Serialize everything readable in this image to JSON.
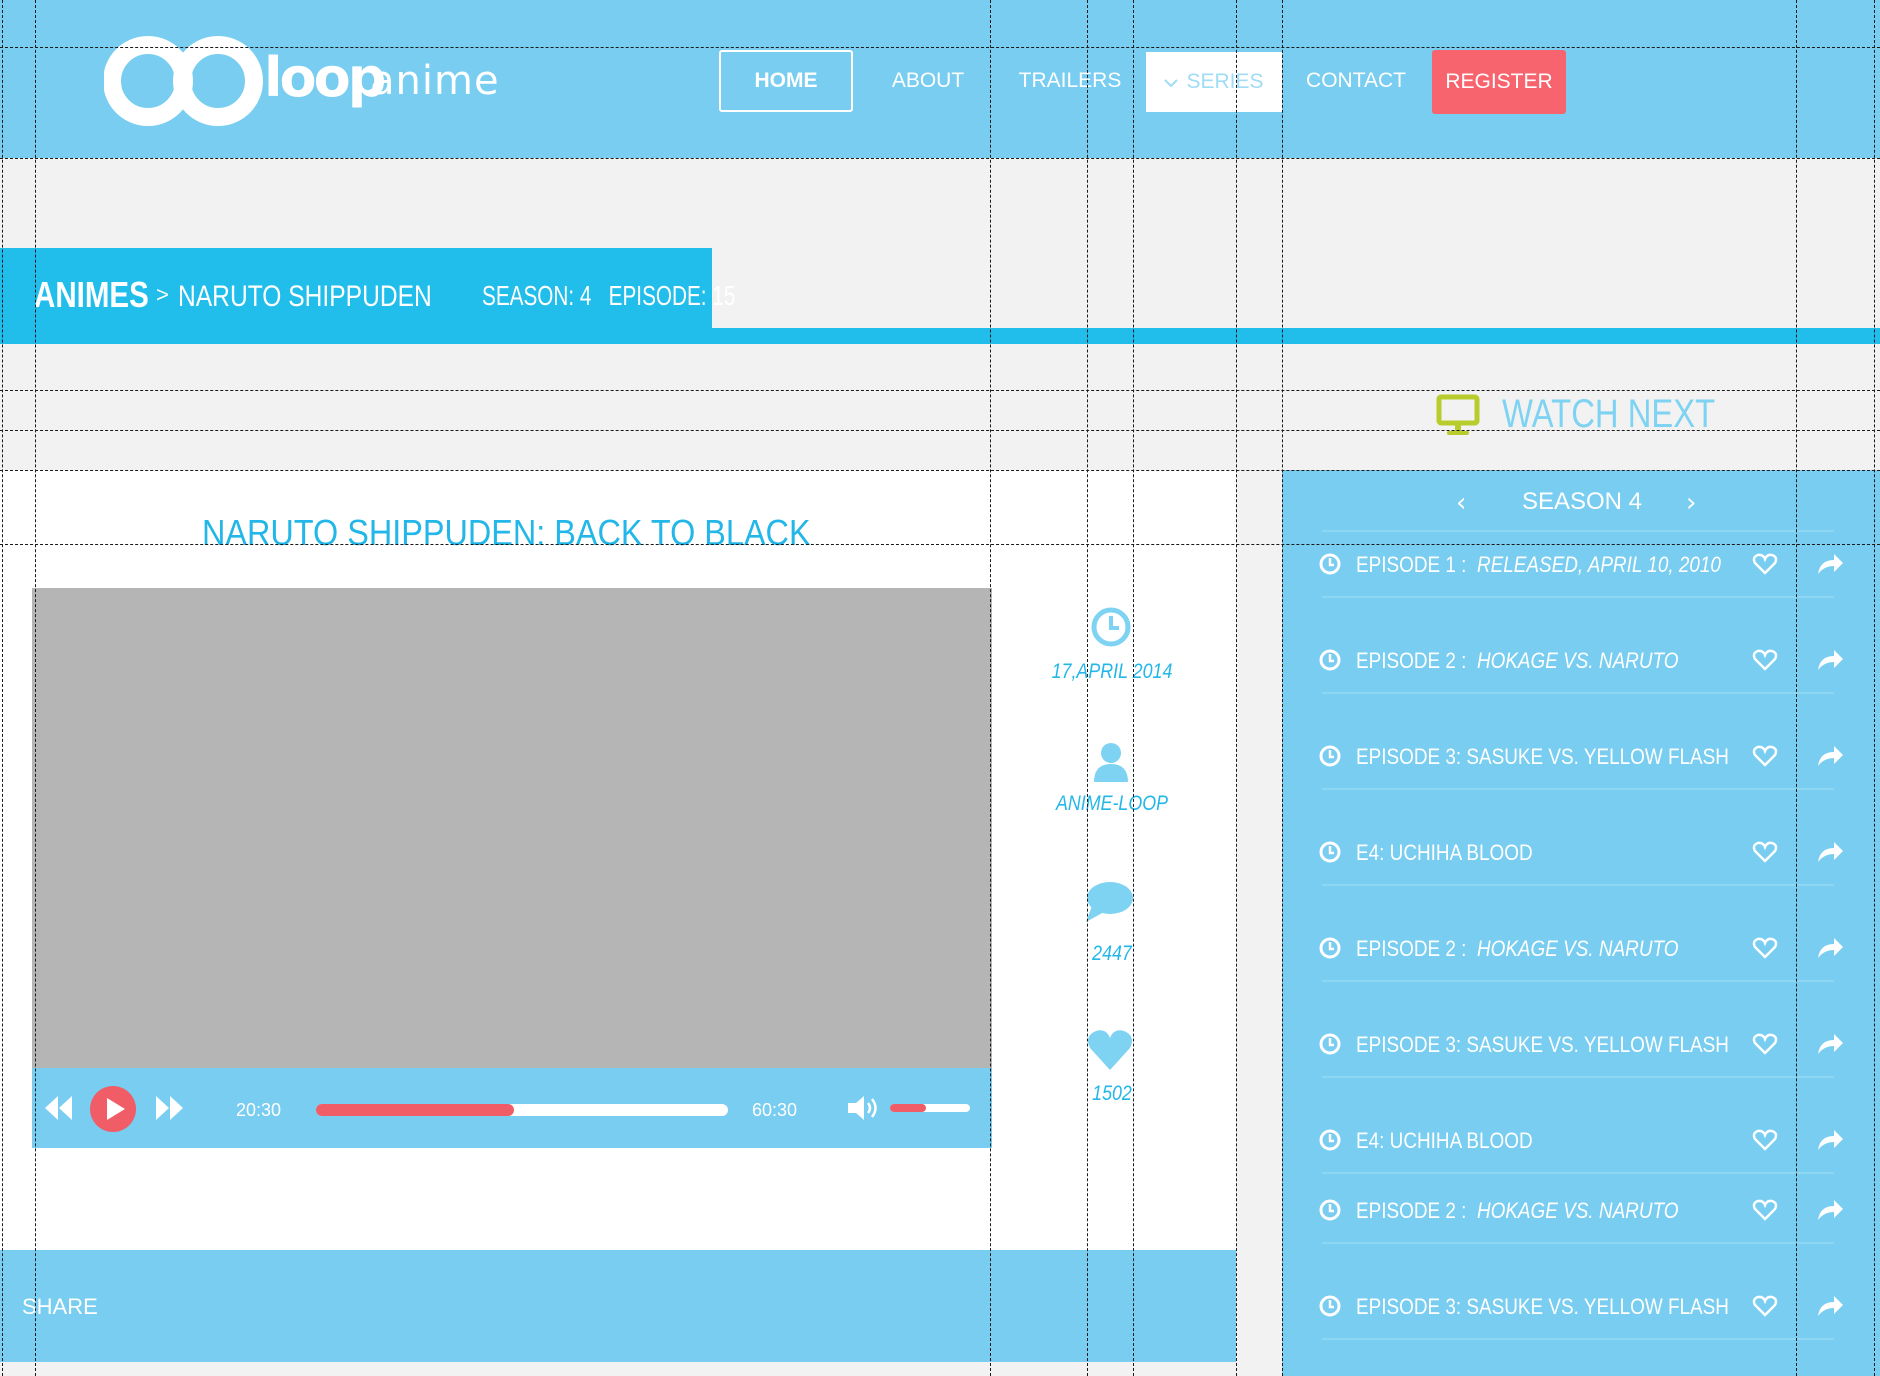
{
  "brand": {
    "name_bold": "loop",
    "name_light": "anime"
  },
  "nav": {
    "home": "HOME",
    "about": "ABOUT",
    "trailers": "TRAILERS",
    "series": "SERIES",
    "contact": "CONTACT",
    "register": "REGISTER"
  },
  "breadcrumb": {
    "root": "ANIMES",
    "separator": ">",
    "show": "NARUTO SHIPPUDEN",
    "episode_info": "SEASON: 4   EPISODE: 15"
  },
  "watch_next": {
    "title": "WATCH NEXT"
  },
  "video": {
    "title": "NARUTO SHIPPUDEN: BACK TO BLACK",
    "current_time": "20:30",
    "total_time": "60:30",
    "progress": 0.48,
    "volume": 0.45
  },
  "meta": {
    "date": "17,APRIL 2014",
    "author": "ANIME-LOOP",
    "comments": "2447",
    "likes": "1502"
  },
  "share": {
    "label": "SHARE"
  },
  "sidebar": {
    "season_label": "SEASON 4",
    "prev": "‹",
    "next": "›",
    "episodes": [
      {
        "label": "EPISODE 1 :",
        "subtitle": "RELEASED, APRIL 10, 2010"
      },
      {
        "label": "EPISODE 2 :",
        "subtitle": "HOKAGE VS. NARUTO"
      },
      {
        "label": "EPISODE 3: SASUKE VS. YELLOW FLASH",
        "subtitle": ""
      },
      {
        "label": "E4: UCHIHA BLOOD",
        "subtitle": ""
      },
      {
        "label": "EPISODE 2 :",
        "subtitle": "HOKAGE VS. NARUTO"
      },
      {
        "label": "EPISODE 3: SASUKE VS. YELLOW FLASH",
        "subtitle": ""
      },
      {
        "label": "E4: UCHIHA BLOOD",
        "subtitle": ""
      },
      {
        "label": "EPISODE 2 :",
        "subtitle": "HOKAGE VS. NARUTO"
      },
      {
        "label": "EPISODE 3: SASUKE VS. YELLOW FLASH",
        "subtitle": ""
      }
    ]
  },
  "colors": {
    "header_bg": "#78cdf0",
    "accent_blue": "#21bdeb",
    "register_red": "#f7646d",
    "progress_red": "#f05d67",
    "watch_icon": "#b8cc2e"
  },
  "icons": {
    "clock": "clock-icon",
    "user": "user-icon",
    "comment": "comment-icon",
    "heart": "heart-icon",
    "share": "share-arrow-icon",
    "monitor": "monitor-icon"
  }
}
